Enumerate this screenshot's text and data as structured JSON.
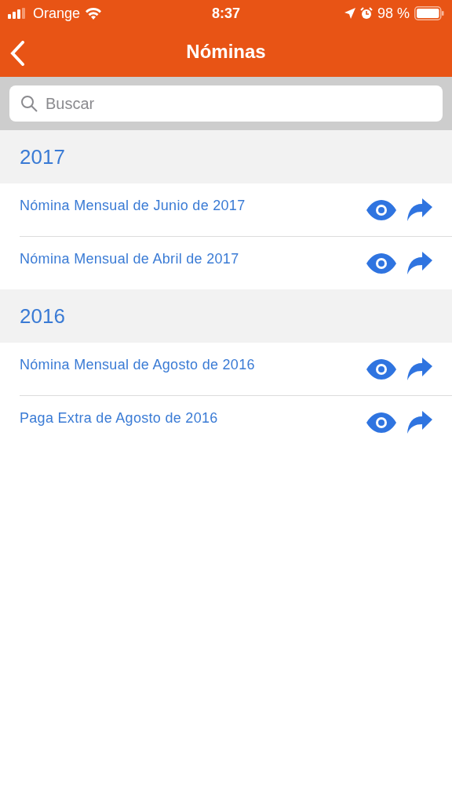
{
  "status_bar": {
    "carrier": "Orange",
    "time": "8:37",
    "battery": "98 %"
  },
  "nav": {
    "title": "Nóminas"
  },
  "search": {
    "placeholder": "Buscar"
  },
  "sections": [
    {
      "year": "2017",
      "items": [
        {
          "title": "Nómina Mensual de Junio de 2017"
        },
        {
          "title": "Nómina Mensual de Abril de 2017"
        }
      ]
    },
    {
      "year": "2016",
      "items": [
        {
          "title": "Nómina Mensual de Agosto de 2016"
        },
        {
          "title": "Paga Extra de Agosto de 2016"
        }
      ]
    }
  ]
}
